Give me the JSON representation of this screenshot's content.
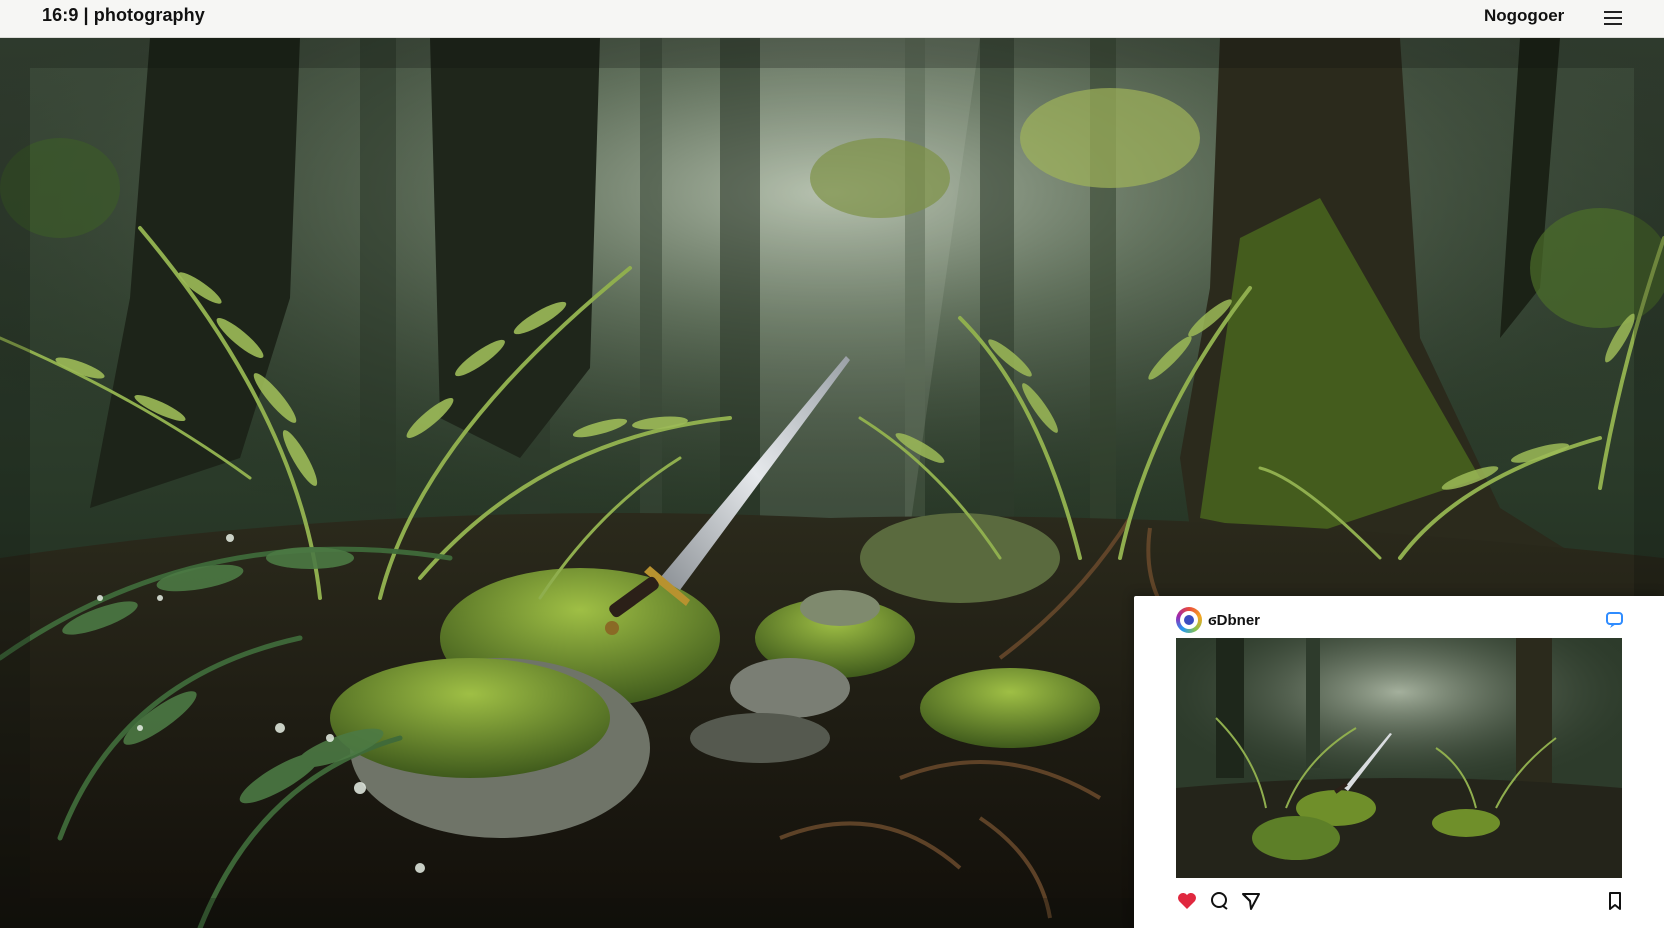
{
  "header": {
    "title": "16:9 | photography",
    "account_name": "Nogogoer",
    "menu_icon": "hamburger-menu-icon"
  },
  "post": {
    "username": "ϭDbner",
    "avatar_icon": "avatar-ring-icon",
    "share_icon": "share-icon",
    "actions": {
      "like_icon": "heart-icon",
      "comment_icon": "comment-icon",
      "send_icon": "send-icon",
      "save_icon": "bookmark-icon"
    },
    "like_color": "#e0283f",
    "share_color": "#2f8cff"
  },
  "colors": {
    "topbar_bg": "#f6f6f4",
    "forest_dark": "#0f1a10",
    "moss": "#6f8f2a",
    "fern": "#8fae4e"
  }
}
